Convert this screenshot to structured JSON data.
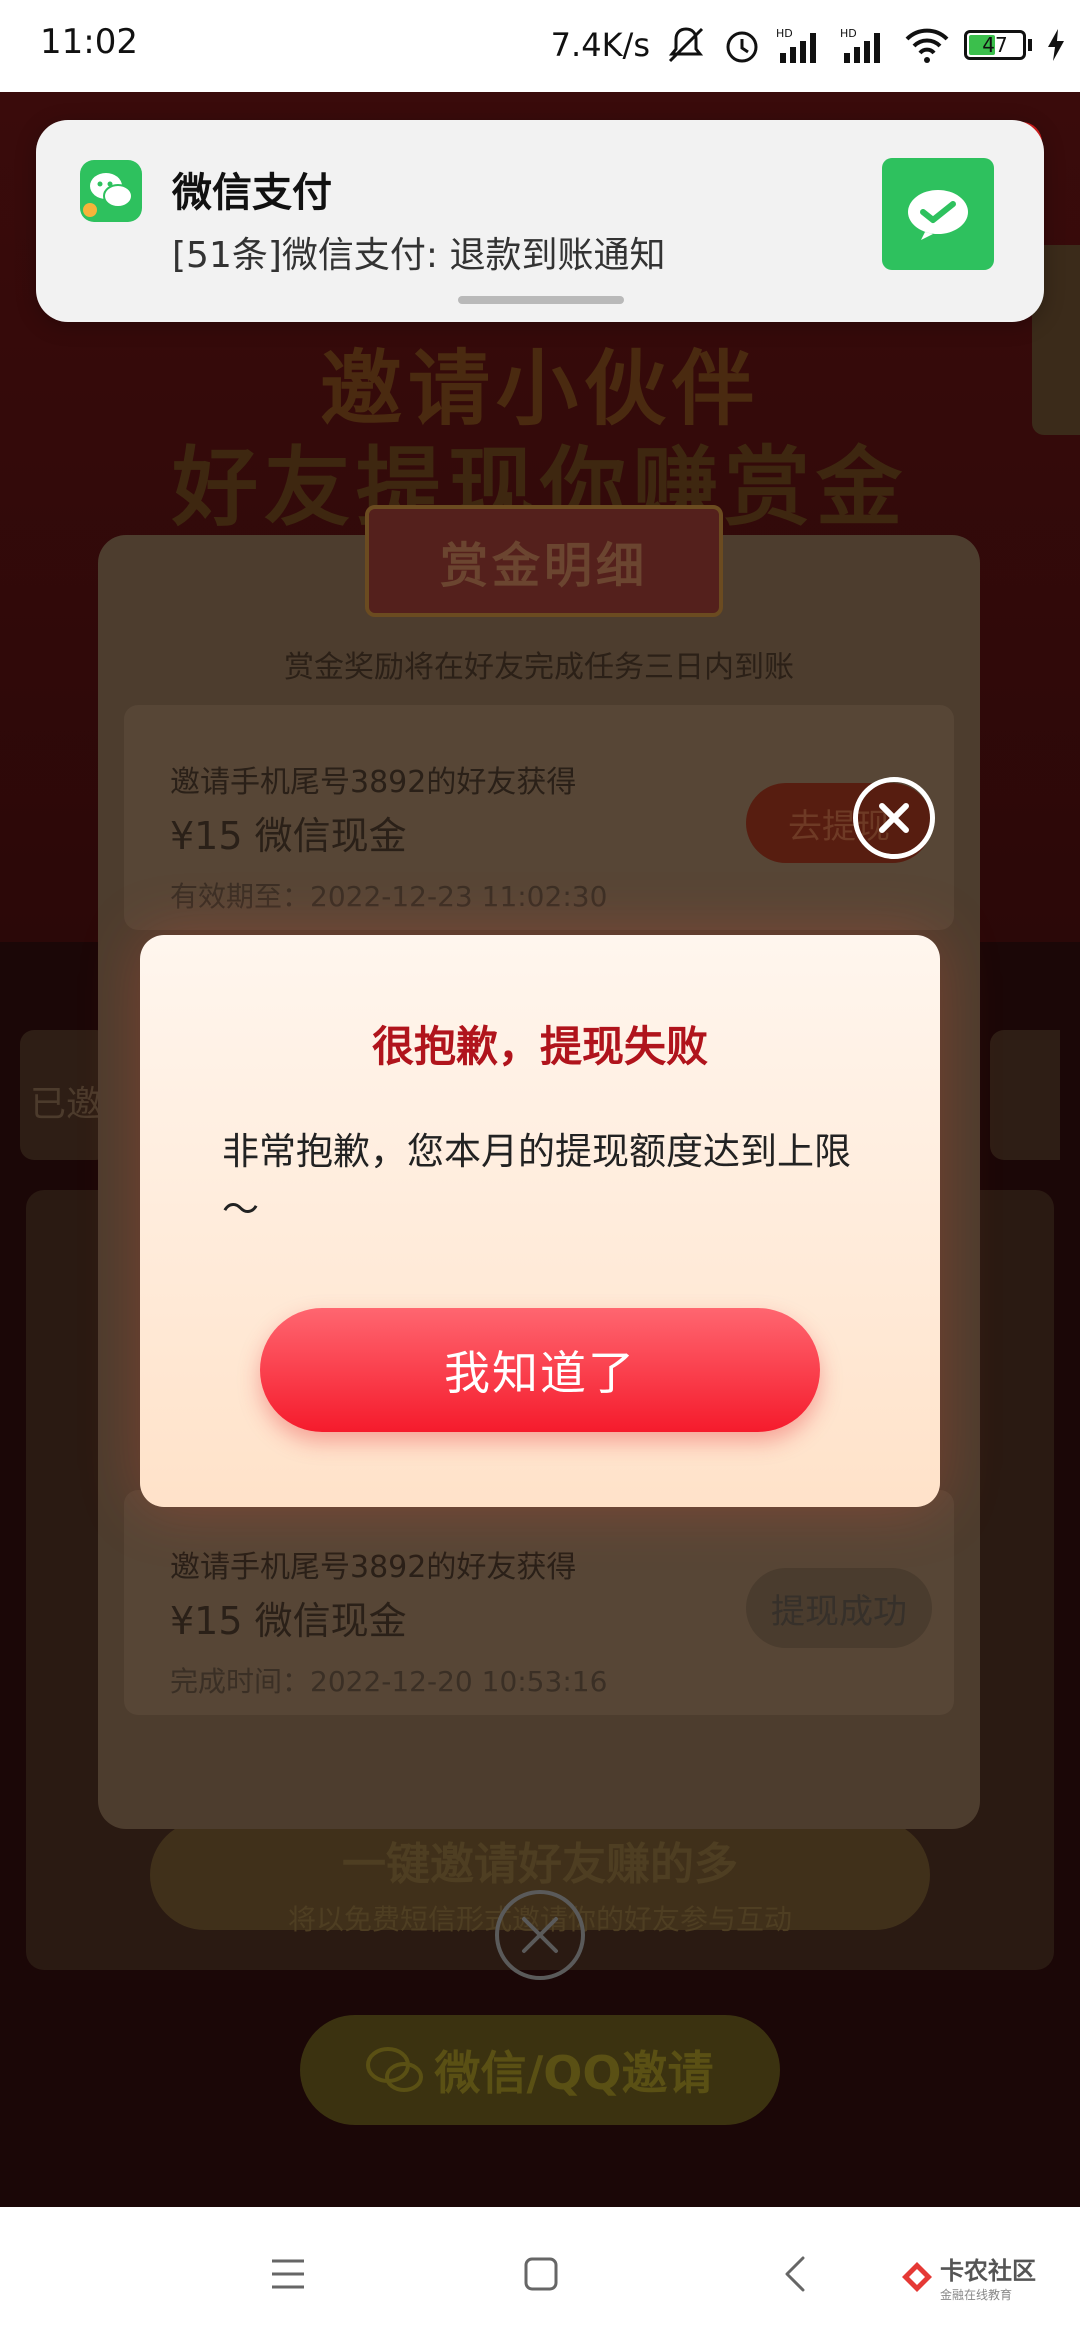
{
  "status_bar": {
    "time": "11:02",
    "network_speed": "7.4K/s",
    "battery": "47",
    "icons": [
      "mute-icon",
      "alarm-icon",
      "signal-hd-icon",
      "signal-hd-icon",
      "wifi-icon",
      "battery-icon",
      "charging-icon"
    ]
  },
  "notification": {
    "app_name": "微信支付",
    "body": "[51条]微信支付: 退款到账通知",
    "accent": "#2ec15e"
  },
  "background_page": {
    "title_line1": "邀请小伙伴",
    "title_line2": "好友提现你赚赏金",
    "invite_cta": "一键邀请好友赚的多",
    "invite_sub": "将以免费短信形式邀请你的好友参与互动",
    "wechat_qq_button": "微信/QQ邀请",
    "side_label": "已邀"
  },
  "bounty_modal": {
    "ribbon_title": "赏金明细",
    "note": "赏金奖励将在好友完成任务三日内到账",
    "rewards": [
      {
        "title": "邀请手机尾号3892的好友获得",
        "amount": "¥15 微信现金",
        "time": "有效期至：2022-12-23 11:02:30",
        "button": "去提现"
      },
      {
        "title": "邀请手机尾号3892的好友获得",
        "amount": "¥15 微信现金",
        "time": "完成时间：2022-12-20 10:53:16",
        "button": "提现成功"
      }
    ]
  },
  "dialog": {
    "title": "很抱歉，提现失败",
    "message": "非常抱歉，您本月的提现额度达到上限～",
    "ok_button": "我知道了",
    "title_color": "#b0141c",
    "button_color": "#f51b2c"
  },
  "nav_bar": {
    "watermark": "卡农社区",
    "watermark_sub": "金融在线教育"
  }
}
